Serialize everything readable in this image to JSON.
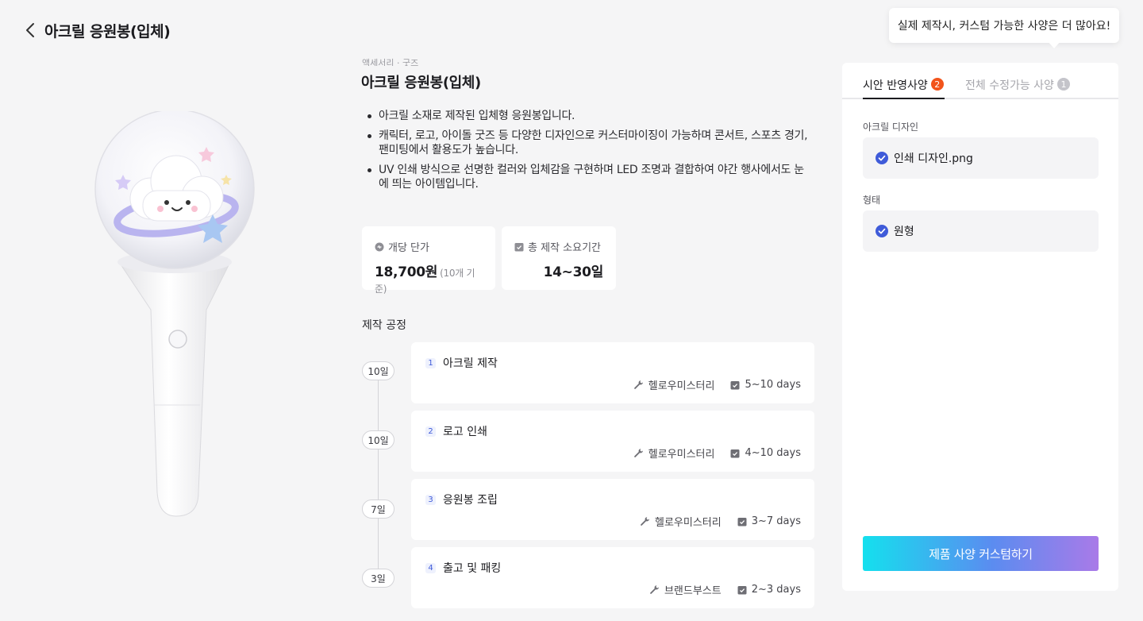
{
  "header": {
    "title": "아크릴 응원봉(입체)"
  },
  "tooltip": {
    "text": "실제 제작시, 커스텀 가능한 사양은 더 많아요!"
  },
  "product": {
    "category": "액세서리 · 굿즈",
    "name": "아크릴 응원봉(입체)",
    "description": [
      "아크릴 소재로 제작된 입체형 응원봉입니다.",
      "캐릭터, 로고, 아이돌 굿즈 등 다양한 디자인으로 커스터마이징이 가능하며 콘서트, 스포츠 경기, 팬미팅에서 활용도가 높습니다.",
      "UV 인쇄 방식으로 선명한 컬러와 입체감을 구현하며 LED 조명과 결합하여 야간 행사에서도 눈에 띄는 아이템입니다."
    ]
  },
  "stats": {
    "unit_price": {
      "label": "개당 단가",
      "value": "18,700원",
      "sub": "(10개 기준)"
    },
    "lead_time": {
      "label": "총 제작 소요기간",
      "value": "14~30일"
    }
  },
  "process": {
    "title": "제작 공정",
    "steps": [
      {
        "num": "1",
        "name": "아크릴 제작",
        "days": "10일",
        "vendor": "헬로우미스터리",
        "duration": "5~10 days"
      },
      {
        "num": "2",
        "name": "로고 인쇄",
        "days": "10일",
        "vendor": "헬로우미스터리",
        "duration": "4~10 days"
      },
      {
        "num": "3",
        "name": "응원봉 조립",
        "days": "7일",
        "vendor": "헬로우미스터리",
        "duration": "3~7 days"
      },
      {
        "num": "4",
        "name": "출고 및 패킹",
        "days": "3일",
        "vendor": "브랜드부스트",
        "duration": "2~3 days"
      }
    ]
  },
  "side_panel": {
    "tabs": [
      {
        "label": "시안 반영사양",
        "badge": "2"
      },
      {
        "label": "전체 수정가능 사양",
        "badge": "1"
      }
    ],
    "fields": [
      {
        "label": "아크릴 디자인",
        "value": "인쇄 디자인.png"
      },
      {
        "label": "형태",
        "value": "원형"
      }
    ],
    "cta_label": "제품 사양 커스텀하기"
  },
  "colors": {
    "accent_blue": "#3f5bd9",
    "badge_red": "#f2541b",
    "gradient_start": "#14e0ee",
    "gradient_end": "#a97ae8"
  }
}
